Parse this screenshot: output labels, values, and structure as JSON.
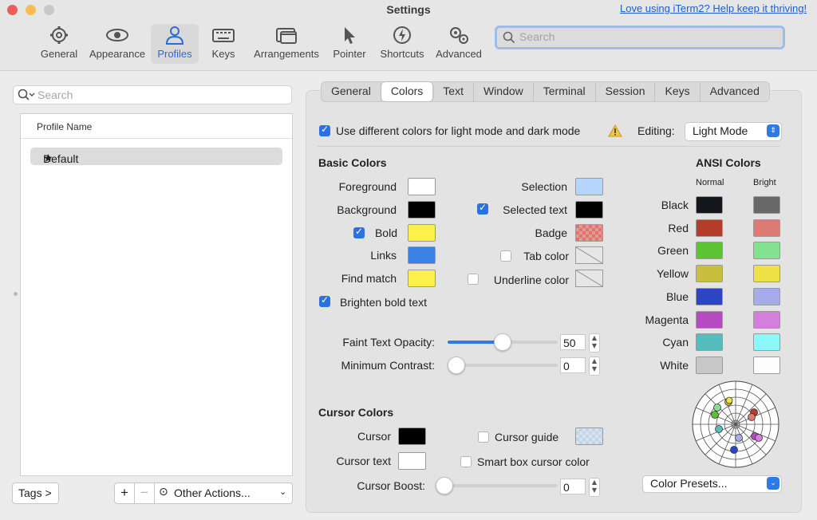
{
  "window": {
    "title": "Settings",
    "promo_link": "Love using iTerm2? Help keep it thriving!"
  },
  "toolbar": {
    "items": [
      {
        "label": "General",
        "icon": "gear-icon"
      },
      {
        "label": "Appearance",
        "icon": "eye-icon"
      },
      {
        "label": "Profiles",
        "icon": "person-icon",
        "selected": true
      },
      {
        "label": "Keys",
        "icon": "keyboard-icon"
      },
      {
        "label": "Arrangements",
        "icon": "windows-icon"
      },
      {
        "label": "Pointer",
        "icon": "pointer-icon"
      },
      {
        "label": "Shortcuts",
        "icon": "bolt-icon"
      },
      {
        "label": "Advanced",
        "icon": "gears-icon"
      }
    ],
    "search_placeholder": "Search"
  },
  "profiles": {
    "search_placeholder": "Search",
    "column_header": "Profile Name",
    "rows": [
      {
        "name": "Default",
        "icon": "star-icon"
      }
    ],
    "tags_button": "Tags >",
    "add_button": "+",
    "remove_button": "−",
    "other_actions": "Other Actions..."
  },
  "tabs": [
    "General",
    "Colors",
    "Text",
    "Window",
    "Terminal",
    "Session",
    "Keys",
    "Advanced"
  ],
  "selected_tab": "Colors",
  "colors": {
    "mode_checkbox_label": "Use different colors for light mode and dark mode",
    "mode_checkbox_checked": true,
    "warning_icon": "warning-icon",
    "editing_label": "Editing:",
    "editing_value": "Light Mode",
    "basic_heading": "Basic Colors",
    "foreground_label": "Foreground",
    "background_label": "Background",
    "bold_label": "Bold",
    "bold_checked": true,
    "links_label": "Links",
    "find_match_label": "Find match",
    "selection_label": "Selection",
    "selected_text_label": "Selected text",
    "selected_text_checked": true,
    "badge_label": "Badge",
    "tab_color_label": "Tab color",
    "tab_color_checked": false,
    "underline_color_label": "Underline color",
    "underline_color_checked": false,
    "brighten_bold_label": "Brighten bold text",
    "brighten_bold_checked": true,
    "faint_opacity_label": "Faint Text Opacity:",
    "faint_opacity_value": "50",
    "min_contrast_label": "Minimum Contrast:",
    "min_contrast_value": "0",
    "cursor_heading": "Cursor Colors",
    "cursor_label": "Cursor",
    "cursor_text_label": "Cursor text",
    "cursor_guide_label": "Cursor guide",
    "cursor_guide_checked": false,
    "smart_box_label": "Smart box cursor color",
    "smart_box_checked": false,
    "cursor_boost_label": "Cursor Boost:",
    "cursor_boost_value": "0",
    "swatches": {
      "foreground": "#ffffff",
      "background": "#000000",
      "bold": "#fdf04a",
      "links": "#3a83e5",
      "find_match": "#fdf04a",
      "selection": "#b5d5fb",
      "selected_text": "#000000",
      "badge": "#d9776f",
      "cursor": "#000000",
      "cursor_text": "#ffffff"
    },
    "ansi_heading": "ANSI Colors",
    "ansi_normal_header": "Normal",
    "ansi_bright_header": "Bright",
    "ansi": [
      {
        "name": "Black",
        "normal": "#14181d",
        "bright": "#686868"
      },
      {
        "name": "Red",
        "normal": "#b43c2a",
        "bright": "#dd7a74"
      },
      {
        "name": "Green",
        "normal": "#5cc432",
        "bright": "#82e290"
      },
      {
        "name": "Yellow",
        "normal": "#c8c03c",
        "bright": "#ede145"
      },
      {
        "name": "Blue",
        "normal": "#2b45c5",
        "bright": "#a6abeb"
      },
      {
        "name": "Magenta",
        "normal": "#b44bbe",
        "bright": "#d57fdc"
      },
      {
        "name": "Cyan",
        "normal": "#56bdbf",
        "bright": "#8bf7f9"
      },
      {
        "name": "White",
        "normal": "#c7c7c7",
        "bright": "#fdfdfd"
      }
    ],
    "presets_label": "Color Presets..."
  }
}
